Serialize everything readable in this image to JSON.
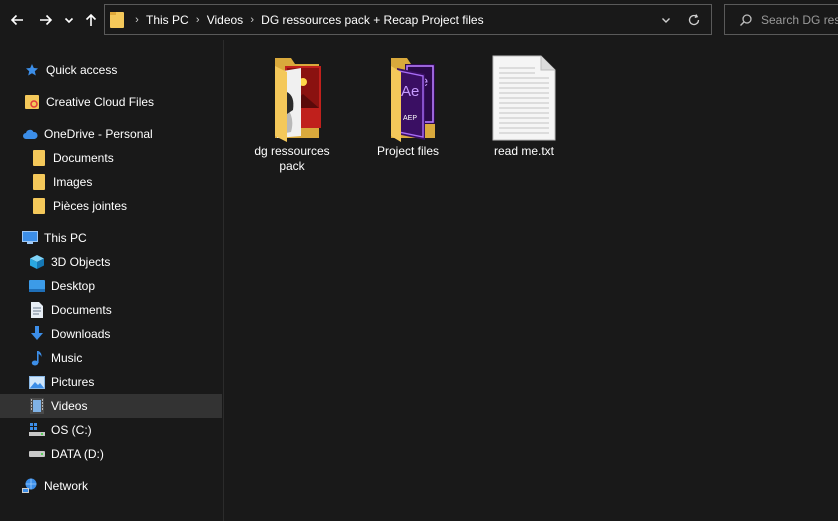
{
  "toolbar": {
    "back_icon": "arrow-left-icon",
    "forward_icon": "arrow-right-icon",
    "recent_icon": "chevron-down-icon",
    "up_icon": "arrow-up-icon"
  },
  "address": {
    "breadcrumbs": [
      "This PC",
      "Videos",
      "DG ressources pack + Recap Project files"
    ]
  },
  "search": {
    "placeholder": "Search DG ressources pack + Recap Project files"
  },
  "sidebar": {
    "items": [
      {
        "label": "Quick access",
        "icon": "star-icon"
      },
      {
        "label": "Creative Cloud Files",
        "icon": "creative-cloud-folder-icon"
      },
      {
        "label": "OneDrive - Personal",
        "icon": "cloud-icon"
      },
      {
        "label": "Documents",
        "icon": "folder-icon"
      },
      {
        "label": "Images",
        "icon": "folder-icon"
      },
      {
        "label": "Pièces jointes",
        "icon": "folder-icon"
      },
      {
        "label": "This PC",
        "icon": "monitor-icon"
      },
      {
        "label": "3D Objects",
        "icon": "cube-icon"
      },
      {
        "label": "Desktop",
        "icon": "desktop-icon"
      },
      {
        "label": "Documents",
        "icon": "document-icon"
      },
      {
        "label": "Downloads",
        "icon": "download-icon"
      },
      {
        "label": "Music",
        "icon": "music-note-icon"
      },
      {
        "label": "Pictures",
        "icon": "picture-icon"
      },
      {
        "label": "Videos",
        "icon": "film-icon"
      },
      {
        "label": "OS (C:)",
        "icon": "windows-drive-icon"
      },
      {
        "label": "DATA (D:)",
        "icon": "drive-icon"
      },
      {
        "label": "Network",
        "icon": "network-icon"
      }
    ],
    "selected": "Videos"
  },
  "files": [
    {
      "label": "dg ressources pack",
      "icon": "folder-preview-icon"
    },
    {
      "label": "Project files",
      "icon": "after-effects-folder-icon"
    },
    {
      "label": "read me.txt",
      "icon": "text-file-icon"
    }
  ],
  "colors": {
    "background": "#191919",
    "selected": "#333333",
    "folder": "#f4c85a",
    "accent_blue": "#3c8ee8",
    "ae_purple": "#9a4ff0"
  }
}
